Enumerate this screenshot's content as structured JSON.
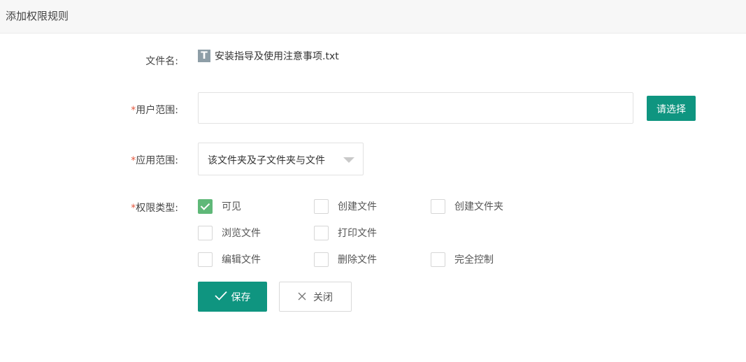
{
  "header": {
    "title": "添加权限规则"
  },
  "form": {
    "filename_label": "文件名:",
    "filename": "安装指导及使用注意事项.txt",
    "file_icon": "T",
    "required_mark": "*",
    "user_scope_label": "用户范围:",
    "user_scope_value": "",
    "choose_button": "请选择",
    "apply_scope_label": "应用范围:",
    "apply_scope_value": "该文件夹及子文件夹与文件",
    "permission_label": "权限类型:",
    "permissions": [
      {
        "label": "可见",
        "checked": true
      },
      {
        "label": "创建文件",
        "checked": false
      },
      {
        "label": "创建文件夹",
        "checked": false
      },
      {
        "label": "浏览文件",
        "checked": false
      },
      {
        "label": "打印文件",
        "checked": false
      },
      {
        "label": "编辑文件",
        "checked": false
      },
      {
        "label": "删除文件",
        "checked": false
      },
      {
        "label": "完全控制",
        "checked": false
      }
    ],
    "save_button": "保存",
    "close_button": "关闭"
  },
  "colors": {
    "accent": "#0f9580",
    "checked": "#5fb878",
    "required": "#e4573d"
  }
}
